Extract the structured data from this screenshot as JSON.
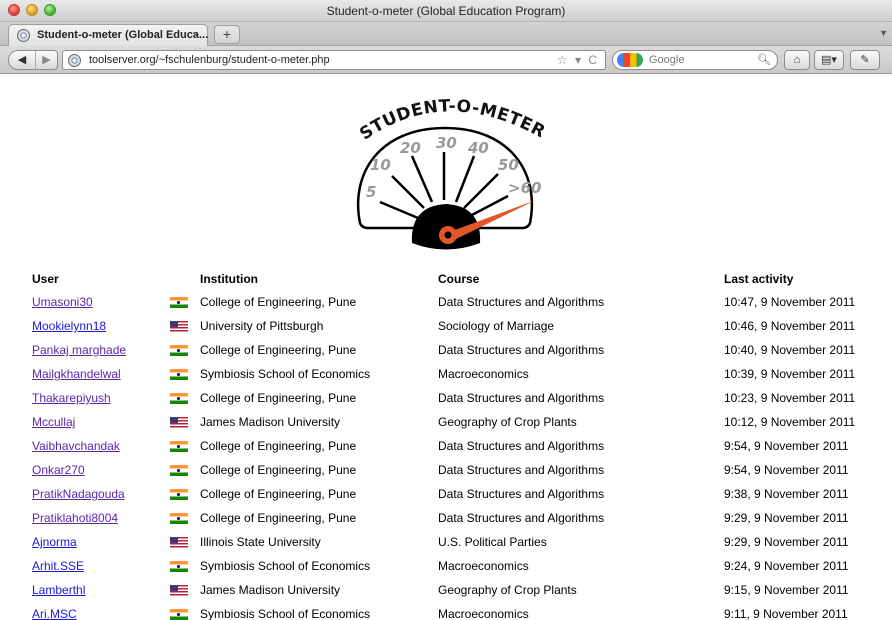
{
  "window": {
    "title": "Student-o-meter (Global Education Program)"
  },
  "tab": {
    "label": "Student-o-meter (Global Educa...",
    "close": "×"
  },
  "newtab_label": "+",
  "nav": {
    "back": "◀",
    "forward": "▶"
  },
  "url": "toolserver.org/~fschulenburg/student-o-meter.php",
  "url_controls": "☆ ▾ C",
  "search": {
    "placeholder": "Google"
  },
  "meter": {
    "title": "STUDENT-O-METER",
    "ticks": [
      "5",
      "10",
      "20",
      "30",
      "40",
      "50",
      ">60"
    ],
    "needle_color": "#e2572a"
  },
  "table": {
    "headers": {
      "user": "User",
      "institution": "Institution",
      "course": "Course",
      "activity": "Last activity"
    },
    "rows": [
      {
        "user": "Umasoni30",
        "flag": "in",
        "institution": "College of Engineering, Pune",
        "course": "Data Structures and Algorithms",
        "time": "10:47, 9 November 2011"
      },
      {
        "user": "Mookielynn18",
        "flag": "us",
        "institution": "University of Pittsburgh",
        "course": "Sociology of Marriage",
        "time": "10:46, 9 November 2011"
      },
      {
        "user": "Pankaj marghade",
        "flag": "in",
        "institution": "College of Engineering, Pune",
        "course": "Data Structures and Algorithms",
        "time": "10:40, 9 November 2011"
      },
      {
        "user": "Mailgkhandelwal",
        "flag": "in",
        "institution": "Symbiosis School of Economics",
        "course": "Macroeconomics",
        "time": "10:39, 9 November 2011"
      },
      {
        "user": "Thakarepiyush",
        "flag": "in",
        "institution": "College of Engineering, Pune",
        "course": "Data Structures and Algorithms",
        "time": "10:23, 9 November 2011"
      },
      {
        "user": "Mccullaj",
        "flag": "us",
        "institution": "James Madison University",
        "course": "Geography of Crop Plants",
        "time": "10:12, 9 November 2011"
      },
      {
        "user": "Vaibhavchandak",
        "flag": "in",
        "institution": "College of Engineering, Pune",
        "course": "Data Structures and Algorithms",
        "time": "9:54, 9 November 2011"
      },
      {
        "user": "Onkar270",
        "flag": "in",
        "institution": "College of Engineering, Pune",
        "course": "Data Structures and Algorithms",
        "time": "9:54, 9 November 2011"
      },
      {
        "user": "PratikNadagouda",
        "flag": "in",
        "institution": "College of Engineering, Pune",
        "course": "Data Structures and Algorithms",
        "time": "9:38, 9 November 2011"
      },
      {
        "user": "Pratiklahoti8004",
        "flag": "in",
        "institution": "College of Engineering, Pune",
        "course": "Data Structures and Algorithms",
        "time": "9:29, 9 November 2011"
      },
      {
        "user": "Ajnorma",
        "flag": "us",
        "institution": "Illinois State University",
        "course": "U.S. Political Parties",
        "time": "9:29, 9 November 2011"
      },
      {
        "user": "Arhit.SSE",
        "flag": "in",
        "institution": "Symbiosis School of Economics",
        "course": "Macroeconomics",
        "time": "9:24, 9 November 2011"
      },
      {
        "user": "Lamberthl",
        "flag": "us",
        "institution": "James Madison University",
        "course": "Geography of Crop Plants",
        "time": "9:15, 9 November 2011"
      },
      {
        "user": "Ari.MSC",
        "flag": "in",
        "institution": "Symbiosis School of Economics",
        "course": "Macroeconomics",
        "time": "9:11, 9 November 2011"
      }
    ]
  }
}
